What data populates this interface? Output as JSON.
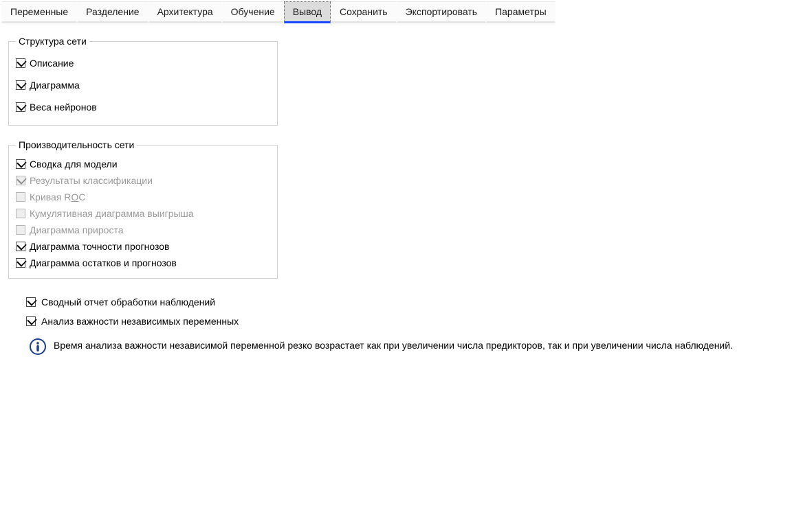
{
  "tabs": [
    {
      "label": "Переменные",
      "active": false
    },
    {
      "label": "Разделение",
      "active": false
    },
    {
      "label": "Архитектура",
      "active": false
    },
    {
      "label": "Обучение",
      "active": false
    },
    {
      "label": "Вывод",
      "active": true
    },
    {
      "label": "Сохранить",
      "active": false
    },
    {
      "label": "Экспортировать",
      "active": false
    },
    {
      "label": "Параметры",
      "active": false
    }
  ],
  "groups": {
    "structure": {
      "legend": "Структура сети",
      "items": [
        {
          "id": "desc",
          "label": "Описание",
          "checked": true,
          "disabled": false
        },
        {
          "id": "diagram",
          "label": "Диаграмма",
          "checked": true,
          "disabled": false
        },
        {
          "id": "weights",
          "label": "Веса нейронов",
          "checked": true,
          "disabled": false
        }
      ]
    },
    "performance": {
      "legend": "Производительность сети",
      "items": [
        {
          "id": "modelsum",
          "label": "Сводка для модели",
          "checked": true,
          "disabled": false
        },
        {
          "id": "classres",
          "label": "Результаты классификации",
          "checked": true,
          "disabled": true
        },
        {
          "id": "roc",
          "label_html": "Кривая R<span class='underline-o'>O</span>C",
          "label": "Кривая ROC",
          "checked": false,
          "disabled": true
        },
        {
          "id": "cumgain",
          "label": "Кумулятивная диаграмма выигрыша",
          "checked": false,
          "disabled": true
        },
        {
          "id": "lift",
          "label": "Диаграмма прироста",
          "checked": false,
          "disabled": true
        },
        {
          "id": "predacc",
          "label": "Диаграмма точности прогнозов",
          "checked": true,
          "disabled": false
        },
        {
          "id": "residplot",
          "label": "Диаграмма остатков и прогнозов",
          "checked": true,
          "disabled": false
        }
      ]
    }
  },
  "standalone": [
    {
      "id": "caseproc",
      "label": "Сводный отчет обработки наблюдений",
      "checked": true,
      "disabled": false
    },
    {
      "id": "varimp",
      "label": "Анализ важности независимых переменных",
      "checked": true,
      "disabled": false
    }
  ],
  "info_note": "Время анализа важности независимой переменной резко возрастает как при увеличении числа предикторов, так и при увеличении числа наблюдений."
}
